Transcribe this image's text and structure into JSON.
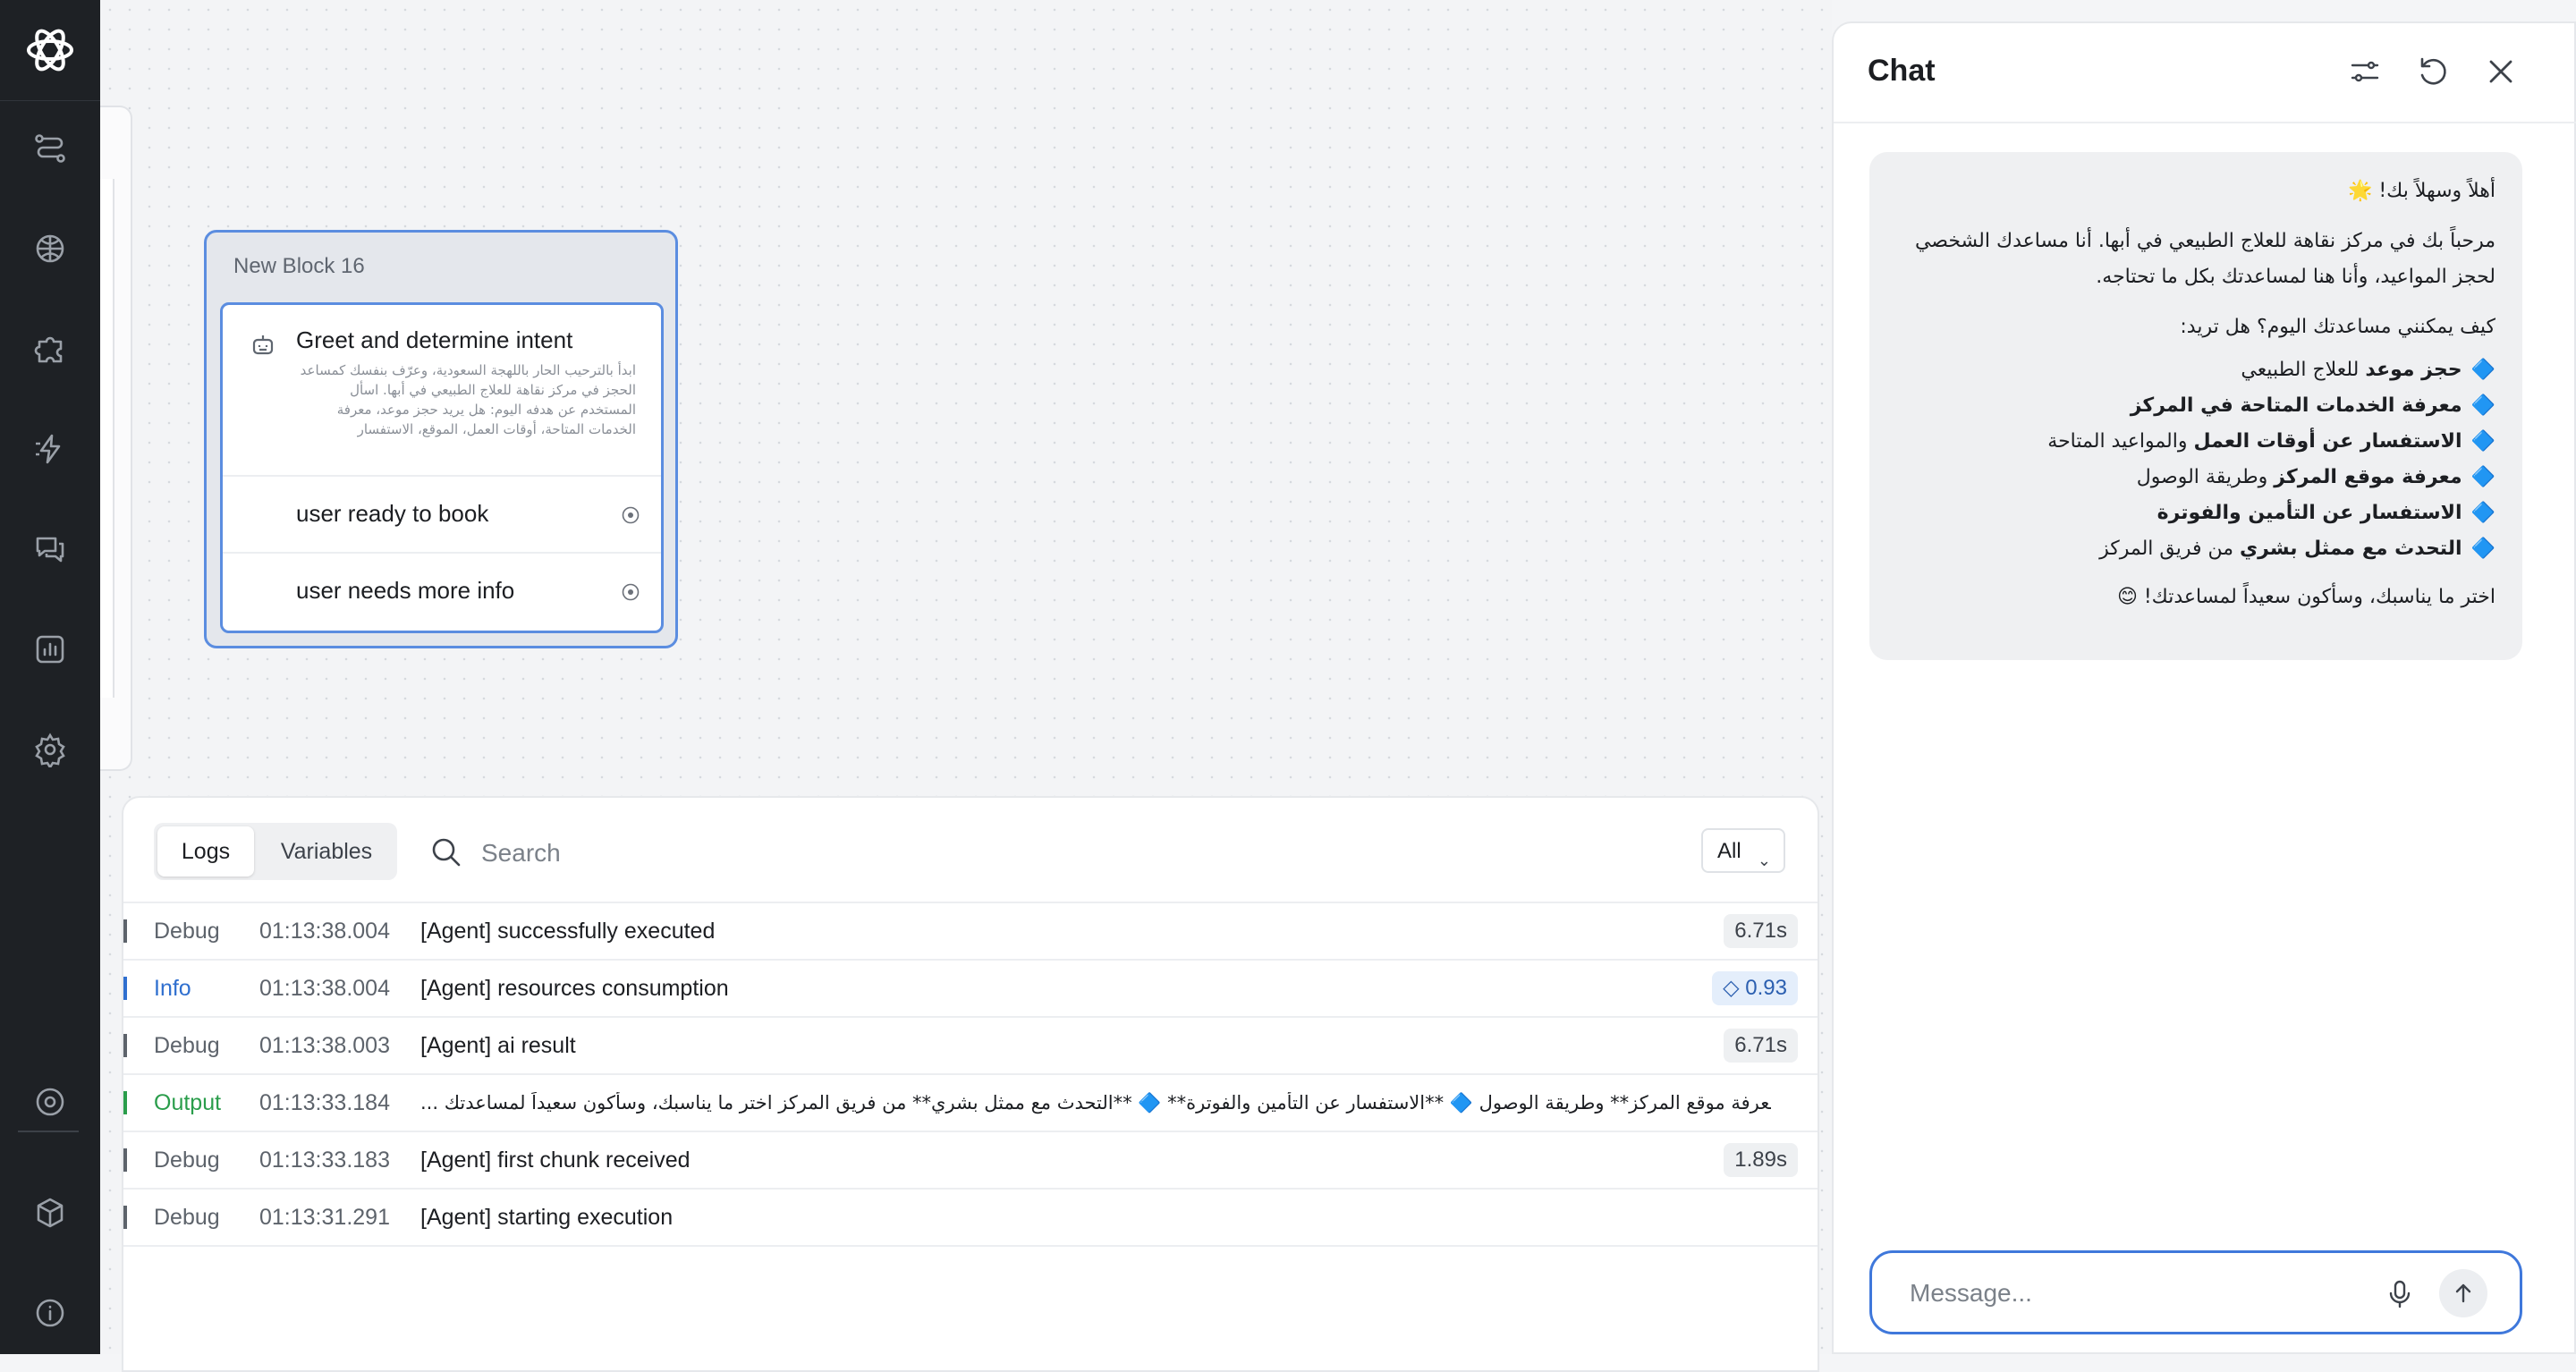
{
  "nav": {
    "items": [
      "flows-icon",
      "knowledge-icon",
      "integrations-icon",
      "actions-icon",
      "conversations-icon",
      "analytics-icon",
      "settings-icon"
    ],
    "bottom": [
      "target-icon",
      "package-icon",
      "info-icon"
    ]
  },
  "block": {
    "title": "New Block 16",
    "step_title": "Greet and determine intent",
    "step_description": "ابدأ بالترحيب الحار باللهجة السعودية، وعرّف بنفسك كمساعد الحجز في مركز نقاهة للعلاج الطبيعي في أبها. اسأل المستخدم عن هدفه اليوم: هل يريد حجز موعد، معرفة الخدمات المتاحة، أوقات العمل، الموقع، الاستفسار",
    "exits": [
      "user ready to book",
      "user needs more info"
    ]
  },
  "logs": {
    "tabs": [
      "Logs",
      "Variables"
    ],
    "active_tab": "Logs",
    "search_placeholder": "Search",
    "filter": "All",
    "rows": [
      {
        "level": "Debug",
        "time": "01:13:38.004",
        "message": "[Agent] successfully executed",
        "badge": "6.71s"
      },
      {
        "level": "Info",
        "time": "01:13:38.004",
        "message": "[Agent] resources consumption",
        "badge": "0.93"
      },
      {
        "level": "Debug",
        "time": "01:13:38.003",
        "message": "[Agent] ai result",
        "badge": "6.71s"
      },
      {
        "level": "Output",
        "time": "01:13:33.184",
        "message": "... والمواعيد المتاحة 🔷 **معرفة موقع المركز** وطريقة الوصول 🔷 **الاستفسار عن التأمين والفوترة** 🔷 **التحدث مع ممثل بشري** من فريق المركز اختر ما يناسبك، وسأكون سعيداً لمساعدتك",
        "badge": ""
      },
      {
        "level": "Debug",
        "time": "01:13:33.183",
        "message": "[Agent] first chunk received",
        "badge": "1.89s"
      },
      {
        "level": "Debug",
        "time": "01:13:31.291",
        "message": "[Agent] starting execution",
        "badge": ""
      }
    ],
    "colors": {
      "Debug": "#5d636b",
      "Info": "#2f6fcf",
      "Output": "#2a9d4b"
    }
  },
  "chat": {
    "title": "Chat",
    "greeting": "أهلاً وسهلاً بك! 🌟",
    "intro": "مرحباً بك في مركز نقاهة للعلاج الطبيعي في أبها. أنا مساعدك الشخصي لحجز المواعيد، وأنا هنا لمساعدتك بكل ما تحتاجه.",
    "question": "كيف يمكنني مساعدتك اليوم؟ هل تريد:",
    "options": [
      {
        "bold": "حجز موعد",
        "rest": " للعلاج الطبيعي"
      },
      {
        "bold": "معرفة الخدمات المتاحة في المركز",
        "rest": ""
      },
      {
        "bold": "الاستفسار عن أوقات العمل",
        "rest": " والمواعيد المتاحة"
      },
      {
        "bold": "معرفة موقع المركز",
        "rest": " وطريقة الوصول"
      },
      {
        "bold": "الاستفسار عن التأمين والفوترة",
        "rest": ""
      },
      {
        "bold": "التحدث مع ممثل بشري",
        "rest": " من فريق المركز"
      }
    ],
    "closing": "اختر ما يناسبك، وسأكون سعيداً لمساعدتك! 😊",
    "input_placeholder": "Message..."
  }
}
